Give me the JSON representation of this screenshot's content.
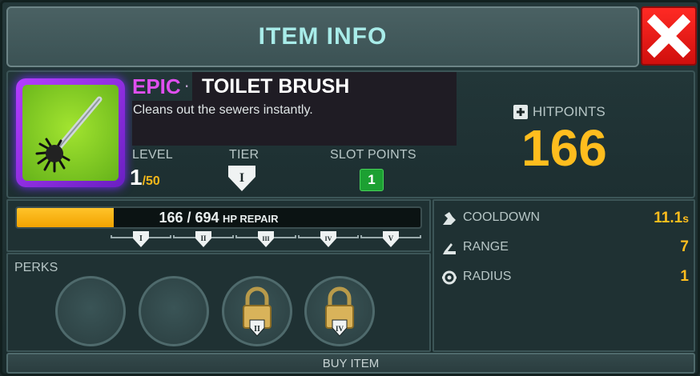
{
  "header": {
    "title": "ITEM INFO"
  },
  "item": {
    "rarity": "EPIC",
    "separator": "·",
    "name": "TOILET BRUSH",
    "description": "Cleans out the sewers instantly.",
    "icon": "toilet-brush-icon"
  },
  "stats": {
    "level_label": "LEVEL",
    "level_current": "1",
    "level_max": "/50",
    "tier_label": "TIER",
    "tier_value": "I",
    "slot_points_label": "SLOT POINTS",
    "slot_points_value": "1",
    "hitpoints_label": "HITPOINTS",
    "hitpoints_value": "166"
  },
  "repair": {
    "text": "166 / 694",
    "unit": "HP REPAIR",
    "current": 166,
    "max": 694,
    "tiers": [
      "I",
      "II",
      "III",
      "IV",
      "V"
    ]
  },
  "perks": {
    "label": "PERKS",
    "slots": [
      {
        "state": "empty"
      },
      {
        "state": "empty"
      },
      {
        "state": "locked",
        "tier": "II"
      },
      {
        "state": "locked",
        "tier": "IV"
      }
    ]
  },
  "side_stats": [
    {
      "label": "COOLDOWN",
      "value": "11.1",
      "unit": "s",
      "icon": "cooldown-icon"
    },
    {
      "label": "RANGE",
      "value": "7",
      "unit": "",
      "icon": "range-icon"
    },
    {
      "label": "RADIUS",
      "value": "1",
      "unit": "",
      "icon": "radius-icon"
    }
  ],
  "buy": {
    "label": "BUY ITEM"
  },
  "colors": {
    "accent": "#a8ece9",
    "rarity_epic": "#e04ff0",
    "gold": "#ffbd1e",
    "close_red": "#e0171a"
  }
}
